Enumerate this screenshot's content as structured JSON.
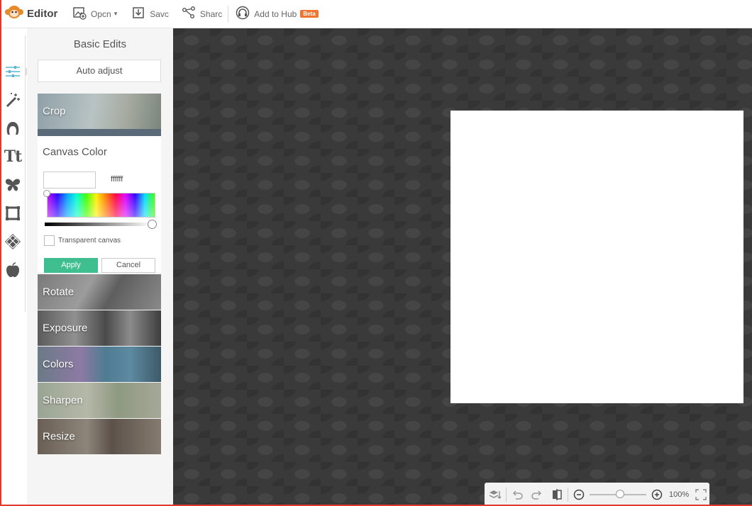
{
  "app": {
    "title": "Editor"
  },
  "toolbar": {
    "open_label": "Opcn",
    "save_label": "Savc",
    "share_label": "Sharc",
    "hub_label": "Add to Hub",
    "hub_badge": "Beta"
  },
  "rail": {
    "items": [
      "basic-edits",
      "effects",
      "touch-up",
      "text",
      "overlays",
      "frames",
      "textures",
      "themes"
    ]
  },
  "panel": {
    "title": "Basic Edits",
    "auto_adjust_label": "Auto adjust",
    "tools": [
      {
        "label": "Crop"
      },
      {
        "label": "Rotate"
      },
      {
        "label": "Exposure"
      },
      {
        "label": "Colors"
      },
      {
        "label": "Sharpen"
      },
      {
        "label": "Resize"
      }
    ]
  },
  "canvas_color": {
    "title": "Canvas Color",
    "hex_value": "ffffff",
    "transparent_label": "Transparent canvas",
    "transparent_checked": false,
    "apply_label": "Apply",
    "cancel_label": "Cancel"
  },
  "bottom": {
    "zoom_value": "100%"
  },
  "colors": {
    "accent_green": "#3fbf8f",
    "beta_orange": "#f0742f",
    "workspace_bg": "#3a3a3a",
    "canvas_color": "#ffffff"
  }
}
